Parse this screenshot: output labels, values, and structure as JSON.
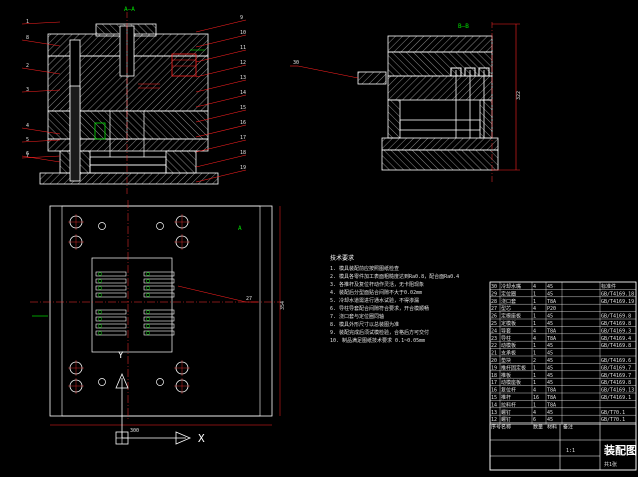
{
  "colors": {
    "background": "#000000",
    "outline": "#ffffff",
    "hatch": "#8a8a8a",
    "leader": "#ff2020",
    "centerline": "#ff3030",
    "dimension": "#00c800",
    "text": "#ffffff",
    "axis": "#ffffff"
  },
  "views": {
    "main_section": {
      "section_label": "A—A",
      "callouts_left": [
        "1",
        "2",
        "3",
        "4",
        "5",
        "6",
        "7",
        "8"
      ],
      "callouts_right": [
        "9",
        "10",
        "11",
        "12",
        "13",
        "14",
        "15",
        "16",
        "17",
        "18",
        "19"
      ]
    },
    "side_section": {
      "section_label": "B—B",
      "callout": "30",
      "dimension": "322"
    },
    "plan_view": {
      "section_mark": "A",
      "callout": "27",
      "width_dim": "300",
      "height_dim": "354",
      "axis_x_label": "X",
      "axis_y_label": "Y"
    }
  },
  "tech_requirements": {
    "title": "技术要求",
    "items": [
      "1. 模具装配前应按照图纸检查",
      "2. 模具各零件加工表面粗糙度达到Ra0.8，配合面Ra0.4",
      "3. 各推杆及复位杆动作灵活，无卡阻现象",
      "4. 装配后分型面贴合间隙不大于0.02mm",
      "5. 冷却水道需进行通水试验，不得渗漏",
      "6. 导柱导套配合间隙符合要求，开合模顺畅",
      "7. 浇口套与定位圈同轴",
      "8. 模具外形尺寸以总装图为准",
      "9. 装配完成后须试模检验，合格后方可交付",
      "10. 制品满足图纸技术要求 0.1~0.05mm"
    ]
  },
  "parts_table": {
    "rows": [
      [
        "30",
        "冷却水嘴",
        "4",
        "45",
        "",
        "标准件"
      ],
      [
        "29",
        "定位圈",
        "1",
        "45",
        "",
        "GB/T4169.18"
      ],
      [
        "28",
        "浇口套",
        "1",
        "T8A",
        "",
        "GB/T4169.19"
      ],
      [
        "27",
        "型芯",
        "4",
        "P20",
        "",
        ""
      ],
      [
        "26",
        "定模座板",
        "1",
        "45",
        "",
        "GB/T4169.8"
      ],
      [
        "25",
        "定模板",
        "1",
        "45",
        "",
        "GB/T4169.8"
      ],
      [
        "24",
        "导套",
        "4",
        "T8A",
        "",
        "GB/T4169.3"
      ],
      [
        "23",
        "导柱",
        "4",
        "T8A",
        "",
        "GB/T4169.4"
      ],
      [
        "22",
        "动模板",
        "1",
        "45",
        "",
        "GB/T4169.8"
      ],
      [
        "21",
        "支承板",
        "1",
        "45",
        "",
        ""
      ],
      [
        "20",
        "垫块",
        "2",
        "45",
        "",
        "GB/T4169.6"
      ],
      [
        "19",
        "推杆固定板",
        "1",
        "45",
        "",
        "GB/T4169.7"
      ],
      [
        "18",
        "推板",
        "1",
        "45",
        "",
        "GB/T4169.7"
      ],
      [
        "17",
        "动模座板",
        "1",
        "45",
        "",
        "GB/T4169.8"
      ],
      [
        "16",
        "复位杆",
        "4",
        "T8A",
        "",
        "GB/T4169.13"
      ],
      [
        "15",
        "推杆",
        "16",
        "T8A",
        "",
        "GB/T4169.1"
      ],
      [
        "14",
        "拉料杆",
        "1",
        "T8A",
        "",
        ""
      ],
      [
        "13",
        "螺钉",
        "4",
        "45",
        "",
        "GB/T70.1"
      ],
      [
        "12",
        "螺钉",
        "6",
        "45",
        "",
        "GB/T70.1"
      ]
    ],
    "header": [
      "序号",
      "名称",
      "数量",
      "材料",
      "备注",
      ""
    ],
    "title": "装配图",
    "scale": "1:1",
    "sheet": "共1张"
  }
}
